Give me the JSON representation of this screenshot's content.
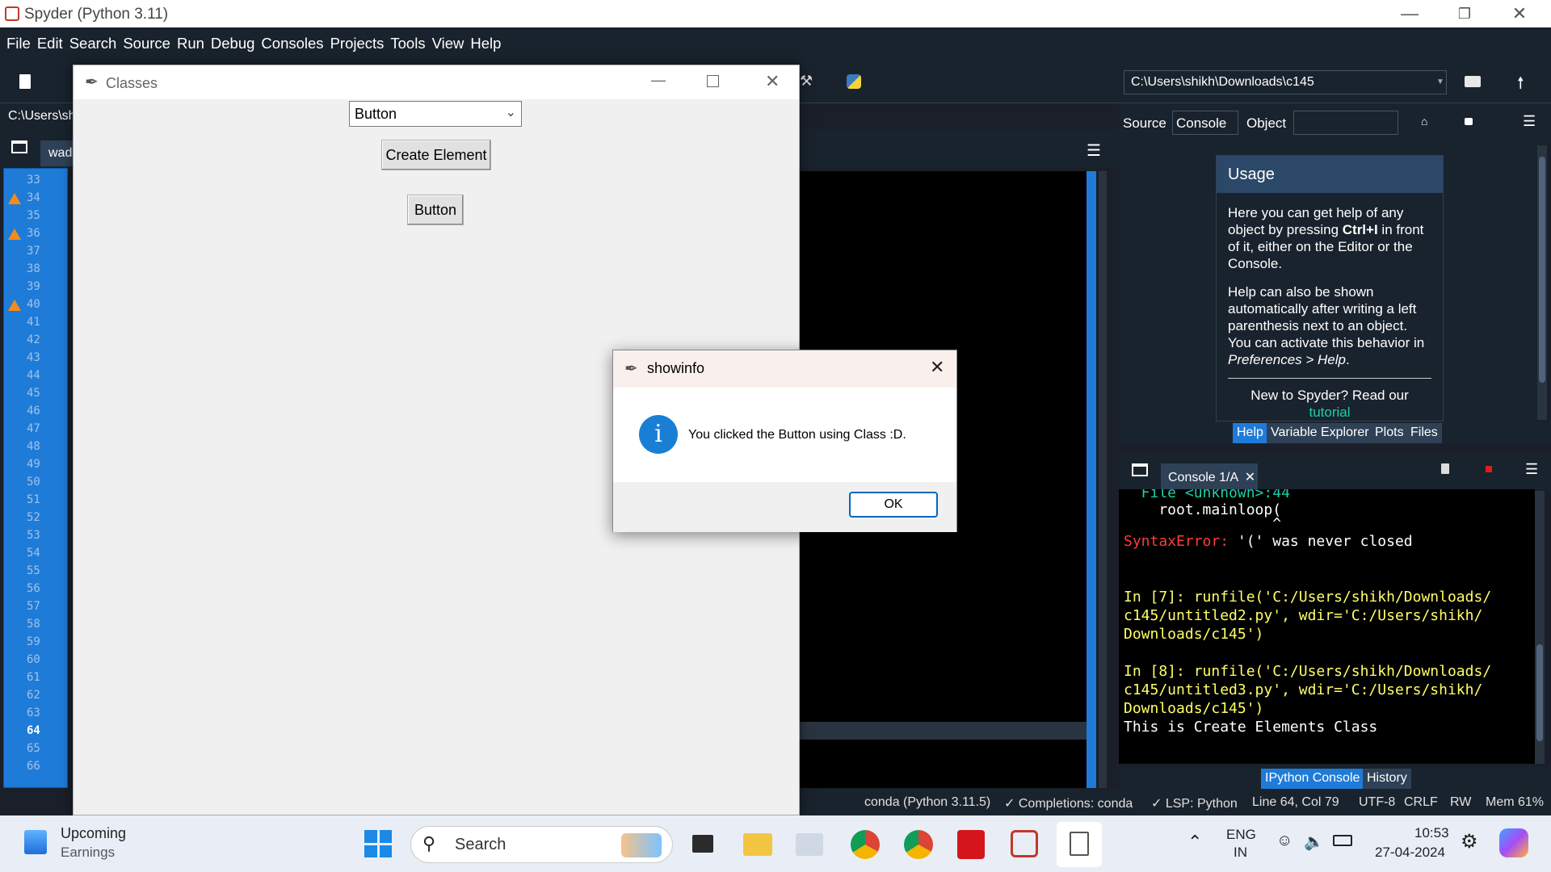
{
  "app": {
    "title": "Spyder (Python 3.11)"
  },
  "menu": [
    "File",
    "Edit",
    "Search",
    "Source",
    "Run",
    "Debug",
    "Consoles",
    "Projects",
    "Tools",
    "View",
    "Help"
  ],
  "toolbar": {
    "path": "C:\\Users\\shikh\\Downloads\\c145"
  },
  "editor": {
    "path_label": "C:\\Users\\sh",
    "tab_label": "wad",
    "line_numbers": [
      "33",
      "34",
      "35",
      "36",
      "37",
      "38",
      "39",
      "40",
      "41",
      "42",
      "43",
      "44",
      "45",
      "46",
      "47",
      "48",
      "49",
      "50",
      "51",
      "52",
      "53",
      "54",
      "55",
      "56",
      "57",
      "58",
      "59",
      "60",
      "61",
      "62",
      "63",
      "64",
      "65",
      "66"
    ]
  },
  "help_pane": {
    "source_label": "Source",
    "source_value": "Console",
    "object_label": "Object",
    "usage_title": "Usage",
    "usage_p1a": "Here you can get help of any object by pressing ",
    "usage_p1b": "Ctrl+I",
    "usage_p1c": " in front of it, either on the Editor or the Console.",
    "usage_p2a": "Help can also be shown automatically after writing a left parenthesis next to an object. You can activate this behavior in ",
    "usage_p2b": "Preferences > Help",
    "usage_p2c": ".",
    "new_to": "New to Spyder? Read our",
    "tutorial": "tutorial",
    "tabs": [
      "Help",
      "Variable Explorer",
      "Plots",
      "Files"
    ]
  },
  "console": {
    "tab_label": "Console 1/A",
    "lines": [
      "  File <unknown>:44",
      "    root.mainloop(",
      "                 ^",
      "",
      "",
      "",
      "In [7]: runfile('C:/Users/shikh/Downloads/",
      "c145/untitled2.py', wdir='C:/Users/shikh/",
      "Downloads/c145')",
      "",
      "In [8]: runfile('C:/Users/shikh/Downloads/",
      "c145/untitled3.py', wdir='C:/Users/shikh/",
      "Downloads/c145')",
      "This is Create Elements Class"
    ],
    "error_label": "SyntaxError:",
    "error_msg": " '(' was never closed",
    "tabs": [
      "IPython Console",
      "History"
    ]
  },
  "statusbar": {
    "conda": "conda (Python 3.11.5)",
    "completions": "Completions: conda",
    "lsp": "LSP: Python",
    "position": "Line 64, Col 79",
    "encoding": "UTF-8",
    "eol": "CRLF",
    "mode": "RW",
    "mem": "Mem 61%"
  },
  "classes_window": {
    "title": "Classes",
    "select_value": "Button",
    "create_button": "Create Element",
    "created_button": "Button"
  },
  "dialog": {
    "title": "showinfo",
    "message": "You clicked the Button using Class :D.",
    "ok": "OK"
  },
  "taskbar": {
    "widget_line1": "Upcoming",
    "widget_line2": "Earnings",
    "search_placeholder": "Search",
    "lang1": "ENG",
    "lang2": "IN",
    "time": "10:53",
    "date": "27-04-2024"
  },
  "colors": {
    "accent": "#1f7bd8",
    "error": "#ff3b3b",
    "prompt": "#23d42f",
    "string": "#ffff66"
  }
}
